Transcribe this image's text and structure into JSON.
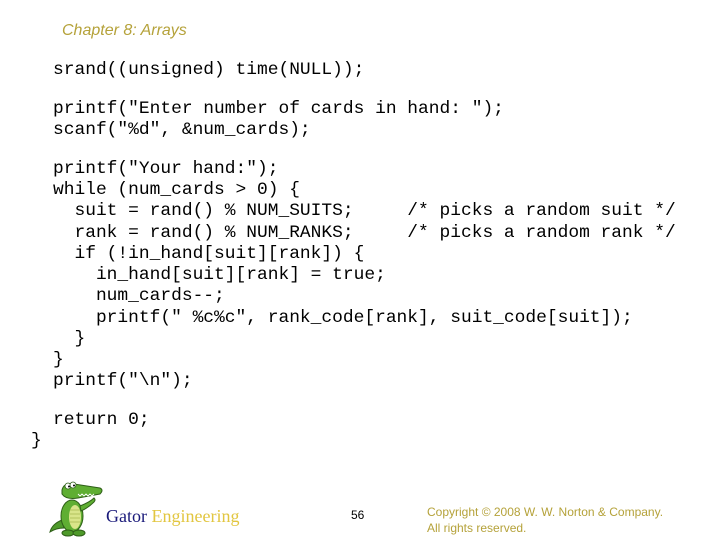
{
  "slide": {
    "chapter_title": "Chapter 8: Arrays",
    "code_lines": [
      "srand((unsigned) time(NULL));",
      "printf(\"Enter number of cards in hand: \");",
      "scanf(\"%d\", &num_cards);",
      "printf(\"Your hand:\");",
      "while (num_cards > 0) {",
      "  suit = rand() % NUM_SUITS;     /* picks a random suit */",
      "  rank = rand() % NUM_RANKS;     /* picks a random rank */",
      "  if (!in_hand[suit][rank]) {",
      "    in_hand[suit][rank] = true;",
      "    num_cards--;",
      "    printf(\" %c%c\", rank_code[rank], suit_code[suit]);",
      "  }",
      "}",
      "printf(\"\\n\");",
      "return 0;",
      "}"
    ]
  },
  "footer": {
    "logo_icon": "gator-mascot-icon",
    "brand_word_1": "Gator",
    "brand_word_2": "Engineering",
    "page_number": "56",
    "copyright_line_1": "Copyright © 2008 W. W. Norton & Company.",
    "copyright_line_2": "All rights reserved."
  },
  "colors": {
    "title": "#b5a23a",
    "gator_blue": "#1a1a7a",
    "engineering_gold": "#e2c640",
    "copyright": "#b5a23a"
  }
}
